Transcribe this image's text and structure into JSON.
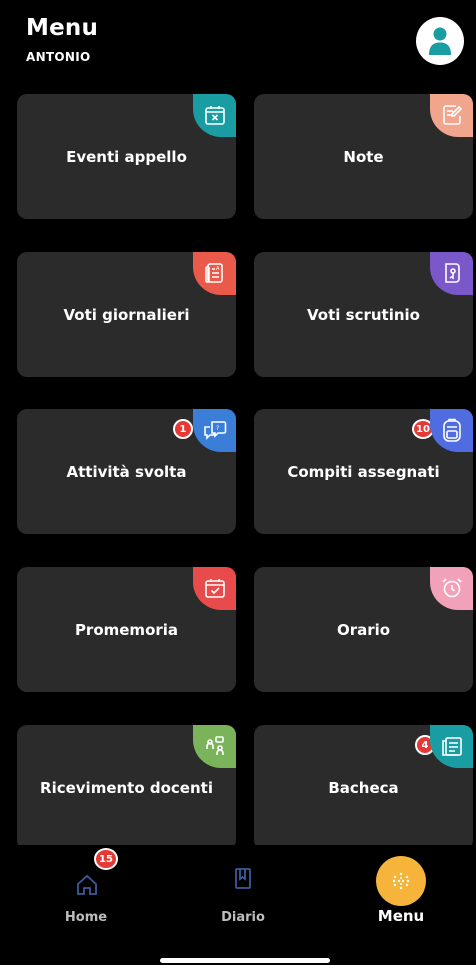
{
  "header": {
    "title": "Menu",
    "user": "ANTONIO"
  },
  "cards": [
    {
      "label": "Eventi appello",
      "icon": "calendar-x-icon",
      "color": "#1a9ca3",
      "badge": null
    },
    {
      "label": "Note",
      "icon": "note-edit-icon",
      "color": "#f0a58c",
      "badge": null
    },
    {
      "label": "Voti giornalieri",
      "icon": "grade-list-icon",
      "color": "#ea5a4b",
      "badge": null
    },
    {
      "label": "Voti scrutinio",
      "icon": "report-card-icon",
      "color": "#7b58c9",
      "badge": null
    },
    {
      "label": "Attività svolta",
      "icon": "chat-question-icon",
      "color": "#3b7ed8",
      "badge": "1"
    },
    {
      "label": "Compiti assegnati",
      "icon": "backpack-icon",
      "color": "#4f6de0",
      "badge": "10"
    },
    {
      "label": "Promemoria",
      "icon": "calendar-check-icon",
      "color": "#e84b4b",
      "badge": null
    },
    {
      "label": "Orario",
      "icon": "alarm-clock-icon",
      "color": "#f2a2b8",
      "badge": null
    },
    {
      "label": "Ricevimento docenti",
      "icon": "teacher-meeting-icon",
      "color": "#7ab35a",
      "badge": null
    },
    {
      "label": "Bacheca",
      "icon": "notice-board-icon",
      "color": "#1a9ca3",
      "badge": "4"
    }
  ],
  "nav": {
    "home": {
      "label": "Home",
      "badge": "15"
    },
    "diario": {
      "label": "Diario"
    },
    "menu": {
      "label": "Menu",
      "color": "#f6b53a"
    }
  }
}
